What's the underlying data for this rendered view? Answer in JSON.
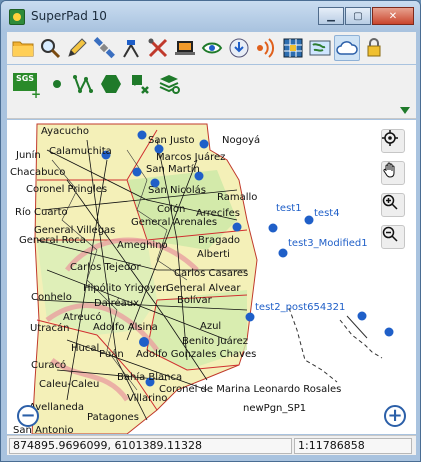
{
  "window": {
    "title": "SuperPad 10"
  },
  "window_controls": {
    "minimize": "▁",
    "maximize": "▢",
    "close": "✕"
  },
  "toolbar1": {
    "icons": [
      "folder-icon",
      "magnifier-icon",
      "pencil-icon",
      "satellite-icon",
      "surveyor-icon",
      "tools-icon",
      "laptop-icon",
      "eye-layer-icon",
      "download-cloud-icon",
      "gps-signal-icon",
      "grid-icon",
      "world-map-icon",
      "cloud-icon",
      "lock-icon"
    ]
  },
  "toolbar2": {
    "sgs_label": "SGS",
    "icons": [
      "sgs-add-icon",
      "point-icon",
      "polyline-icon",
      "polygon-icon",
      "delete-feature-icon",
      "layer-settings-icon"
    ]
  },
  "map": {
    "place_labels": [
      "Ayacucho",
      "San Justo",
      "Nogoyá",
      "Calamuchita",
      "Junín",
      "Marcos Juárez",
      "Chacabuco",
      "San Martín",
      "Coronel Pringles",
      "San Nicolás",
      "Ramallo",
      "Río Cuarto",
      "Colón",
      "General Arenales",
      "Arrecifes",
      "General Villegas",
      "Bragado",
      "General Roca",
      "Ameghino",
      "Alberti",
      "Carlos Tejedor",
      "Carlos Casares",
      "Conhelo",
      "Hipólito Yrigoyen",
      "General Alvear",
      "Dairéaux",
      "Bolívar",
      "Atreucó",
      "Utracán",
      "Adolfo Alsina",
      "Azul",
      "Hucal",
      "Benito Juárez",
      "Curacó",
      "Puán",
      "Adolfo Gonzales Chaves",
      "Caleu-Caleu",
      "Bahía Blanca",
      "Villarino",
      "Coronel de Marina Leonardo Rosales",
      "Avellaneda",
      "Patagones",
      "San Antonio"
    ],
    "feature_labels": [
      "test1",
      "test4",
      "test3_Modified1",
      "test2_post654321",
      "newPgn_SP1"
    ],
    "tool_buttons": [
      "locate-icon",
      "pan-hand-icon",
      "zoom-in-icon",
      "zoom-out-icon"
    ],
    "zoom_minus": "−",
    "zoom_plus": "+"
  },
  "status": {
    "coordinates": "874895.9696099, 6101389.11328",
    "scale": "1:11786858"
  }
}
